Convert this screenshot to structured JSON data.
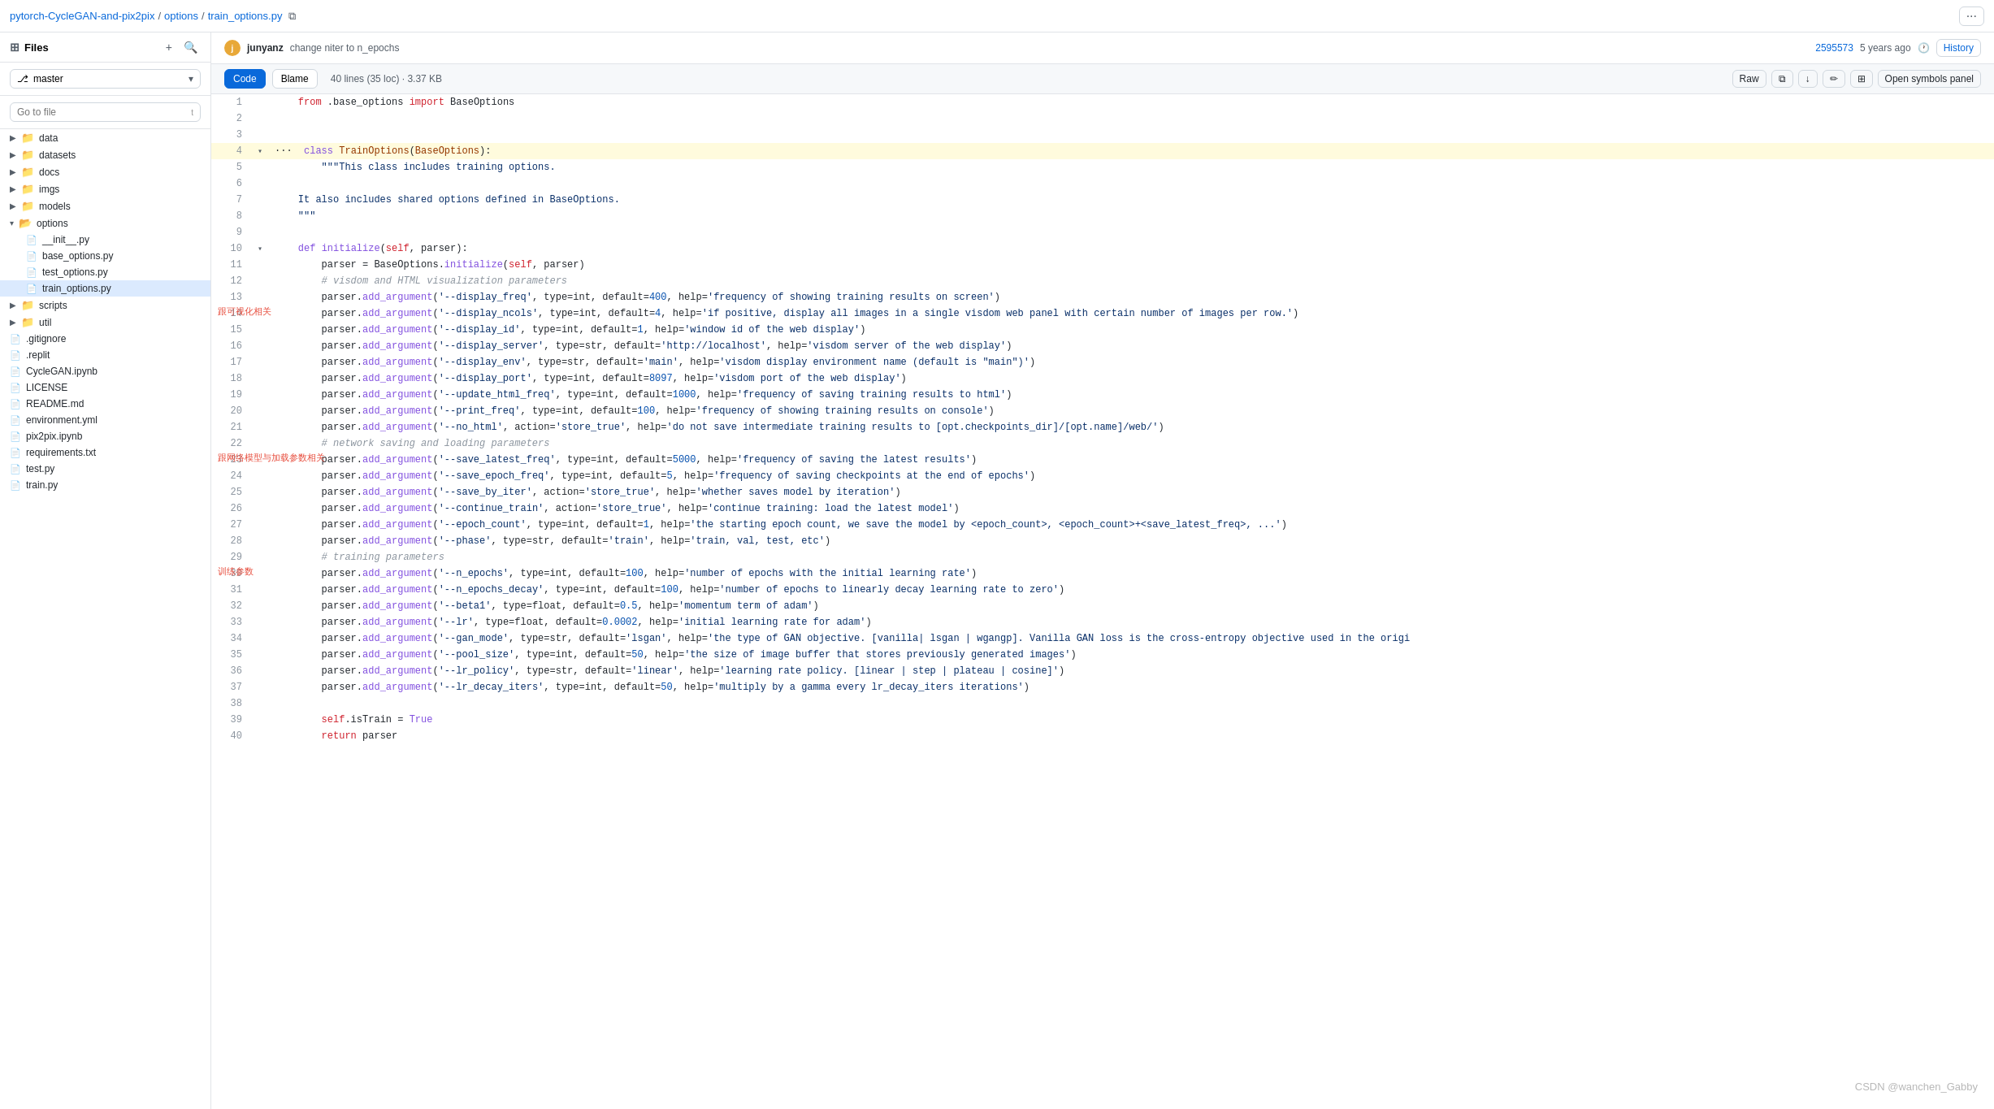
{
  "topbar": {
    "repo": "pytorch-CycleGAN-and-pix2pix",
    "sep1": "/",
    "folder": "options",
    "sep2": "/",
    "file": "train_options.py",
    "more_label": "···"
  },
  "sidebar": {
    "title": "Files",
    "branch_label": "master",
    "search_placeholder": "Go to file",
    "search_shortcut": "t",
    "tree": [
      {
        "id": "data",
        "type": "folder",
        "name": "data",
        "indent": 0,
        "expanded": false
      },
      {
        "id": "datasets",
        "type": "folder",
        "name": "datasets",
        "indent": 0,
        "expanded": false
      },
      {
        "id": "docs",
        "type": "folder",
        "name": "docs",
        "indent": 0,
        "expanded": false
      },
      {
        "id": "imgs",
        "type": "folder",
        "name": "imgs",
        "indent": 0,
        "expanded": false
      },
      {
        "id": "models",
        "type": "folder",
        "name": "models",
        "indent": 0,
        "expanded": false
      },
      {
        "id": "options",
        "type": "folder",
        "name": "options",
        "indent": 0,
        "expanded": true
      },
      {
        "id": "init_py",
        "type": "file",
        "name": "__init__.py",
        "indent": 1
      },
      {
        "id": "base_options",
        "type": "file",
        "name": "base_options.py",
        "indent": 1
      },
      {
        "id": "test_options",
        "type": "file",
        "name": "test_options.py",
        "indent": 1
      },
      {
        "id": "train_options",
        "type": "file",
        "name": "train_options.py",
        "indent": 1,
        "active": true
      },
      {
        "id": "scripts",
        "type": "folder",
        "name": "scripts",
        "indent": 0,
        "expanded": false
      },
      {
        "id": "util",
        "type": "folder",
        "name": "util",
        "indent": 0,
        "expanded": false
      },
      {
        "id": "gitignore",
        "type": "file",
        "name": ".gitignore",
        "indent": 0
      },
      {
        "id": "replit",
        "type": "file",
        "name": ".replit",
        "indent": 0
      },
      {
        "id": "cyclegan_ipynb",
        "type": "file",
        "name": "CycleGAN.ipynb",
        "indent": 0
      },
      {
        "id": "license",
        "type": "file",
        "name": "LICENSE",
        "indent": 0
      },
      {
        "id": "readme",
        "type": "file",
        "name": "README.md",
        "indent": 0
      },
      {
        "id": "env_yml",
        "type": "file",
        "name": "environment.yml",
        "indent": 0
      },
      {
        "id": "pix2pix_ipynb",
        "type": "file",
        "name": "pix2pix.ipynb",
        "indent": 0
      },
      {
        "id": "requirements",
        "type": "file",
        "name": "requirements.txt",
        "indent": 0
      },
      {
        "id": "test_py",
        "type": "file",
        "name": "test.py",
        "indent": 0
      },
      {
        "id": "train_py",
        "type": "file",
        "name": "train.py",
        "indent": 0
      }
    ]
  },
  "commit_bar": {
    "avatar_initial": "j",
    "author": "junyanz",
    "message": "change niter to n_epochs",
    "hash": "2595573",
    "time": "5 years ago",
    "history_label": "History"
  },
  "file_header": {
    "code_tab": "Code",
    "blame_tab": "Blame",
    "file_info": "40 lines (35 loc) · 3.37 KB",
    "raw_label": "Raw",
    "copy_label": "⧉",
    "download_label": "↓",
    "edit_label": "✏",
    "panel_label": "⊞",
    "open_symbols": "Open symbols panel"
  },
  "annotations": {
    "visdom": "跟可视化相关",
    "network": "跟网络模型与加载参数相关",
    "training": "训练参数"
  },
  "code": {
    "lines": [
      {
        "num": 1,
        "content": "    from .base_options import BaseOptions",
        "type": "normal"
      },
      {
        "num": 2,
        "content": "",
        "type": "normal"
      },
      {
        "num": 3,
        "content": "",
        "type": "normal"
      },
      {
        "num": 4,
        "content": "class TrainOptions(BaseOptions):",
        "type": "highlighted",
        "expandable": true
      },
      {
        "num": 5,
        "content": "    \"\"\"This class includes training options.",
        "type": "normal"
      },
      {
        "num": 6,
        "content": "",
        "type": "normal"
      },
      {
        "num": 7,
        "content": "    It also includes shared options defined in BaseOptions.",
        "type": "normal"
      },
      {
        "num": 8,
        "content": "    \"\"\"",
        "type": "normal"
      },
      {
        "num": 9,
        "content": "",
        "type": "normal"
      },
      {
        "num": 10,
        "content": "    def initialize(self, parser):",
        "type": "normal",
        "expandable": true
      },
      {
        "num": 11,
        "content": "        parser = BaseOptions.initialize(self, parser)",
        "type": "normal"
      },
      {
        "num": 12,
        "content": "        # visdom and HTML visualization parameters",
        "type": "normal"
      },
      {
        "num": 13,
        "content": "        parser.add_argument('--display_freq', type=int, default=400, help='frequency of showing training results on screen')",
        "type": "normal"
      },
      {
        "num": 14,
        "content": "        parser.add_argument('--display_ncols', type=int, default=4, help='if positive, display all images in a single visdom web panel with certain number of images per row.')",
        "type": "normal"
      },
      {
        "num": 15,
        "content": "        parser.add_argument('--display_id', type=int, default=1, help='window id of the web display')",
        "type": "normal"
      },
      {
        "num": 16,
        "content": "        parser.add_argument('--display_server', type=str, default='http://localhost', help='visdom server of the web display')",
        "type": "normal"
      },
      {
        "num": 17,
        "content": "        parser.add_argument('--display_env', type=str, default='main', help='visdom display environment name (default is \"main\")')",
        "type": "normal"
      },
      {
        "num": 18,
        "content": "        parser.add_argument('--display_port', type=int, default=8097, help='visdom port of the web display')",
        "type": "normal"
      },
      {
        "num": 19,
        "content": "        parser.add_argument('--update_html_freq', type=int, default=1000, help='frequency of saving training results to html')",
        "type": "normal"
      },
      {
        "num": 20,
        "content": "        parser.add_argument('--print_freq', type=int, default=100, help='frequency of showing training results on console')",
        "type": "normal"
      },
      {
        "num": 21,
        "content": "        parser.add_argument('--no_html', action='store_true', help='do not save intermediate training results to [opt.checkpoints_dir]/[opt.name]/web/')",
        "type": "normal"
      },
      {
        "num": 22,
        "content": "        # network saving and loading parameters",
        "type": "normal"
      },
      {
        "num": 23,
        "content": "        parser.add_argument('--save_latest_freq', type=int, default=5000, help='frequency of saving the latest results')",
        "type": "normal"
      },
      {
        "num": 24,
        "content": "        parser.add_argument('--save_epoch_freq', type=int, default=5, help='frequency of saving checkpoints at the end of epochs')",
        "type": "normal"
      },
      {
        "num": 25,
        "content": "        parser.add_argument('--save_by_iter', action='store_true', help='whether saves model by iteration')",
        "type": "normal"
      },
      {
        "num": 26,
        "content": "        parser.add_argument('--continue_train', action='store_true', help='continue training: load the latest model')",
        "type": "normal"
      },
      {
        "num": 27,
        "content": "        parser.add_argument('--epoch_count', type=int, default=1, help='the starting epoch count, we save the model by <epoch_count>, <epoch_count>+<save_latest_freq>, ...')",
        "type": "normal"
      },
      {
        "num": 28,
        "content": "        parser.add_argument('--phase', type=str, default='train', help='train, val, test, etc')",
        "type": "normal"
      },
      {
        "num": 29,
        "content": "        # training parameters",
        "type": "normal"
      },
      {
        "num": 30,
        "content": "        parser.add_argument('--n_epochs', type=int, default=100, help='number of epochs with the initial learning rate')",
        "type": "normal"
      },
      {
        "num": 31,
        "content": "        parser.add_argument('--n_epochs_decay', type=int, default=100, help='number of epochs to linearly decay learning rate to zero')",
        "type": "normal"
      },
      {
        "num": 32,
        "content": "        parser.add_argument('--beta1', type=float, default=0.5, help='momentum term of adam')",
        "type": "normal"
      },
      {
        "num": 33,
        "content": "        parser.add_argument('--lr', type=float, default=0.0002, help='initial learning rate for adam')",
        "type": "normal"
      },
      {
        "num": 34,
        "content": "        parser.add_argument('--gan_mode', type=str, default='lsgan', help='the type of GAN objective. [vanilla| lsgan | wgangp]. Vanilla GAN loss is the cross-entropy objective used in the origi",
        "type": "normal"
      },
      {
        "num": 35,
        "content": "        parser.add_argument('--pool_size', type=int, default=50, help='the size of image buffer that stores previously generated images')",
        "type": "normal"
      },
      {
        "num": 36,
        "content": "        parser.add_argument('--lr_policy', type=str, default='linear', help='learning rate policy. [linear | step | plateau | cosine]')",
        "type": "normal"
      },
      {
        "num": 37,
        "content": "        parser.add_argument('--lr_decay_iters', type=int, default=50, help='multiply by a gamma every lr_decay_iters iterations')",
        "type": "normal"
      },
      {
        "num": 38,
        "content": "",
        "type": "normal"
      },
      {
        "num": 39,
        "content": "        self.isTrain = True",
        "type": "normal"
      },
      {
        "num": 40,
        "content": "        return parser",
        "type": "normal"
      }
    ]
  },
  "watermark": "CSDN @wanchen_Gabby",
  "tooltip": "Open symbols panel"
}
